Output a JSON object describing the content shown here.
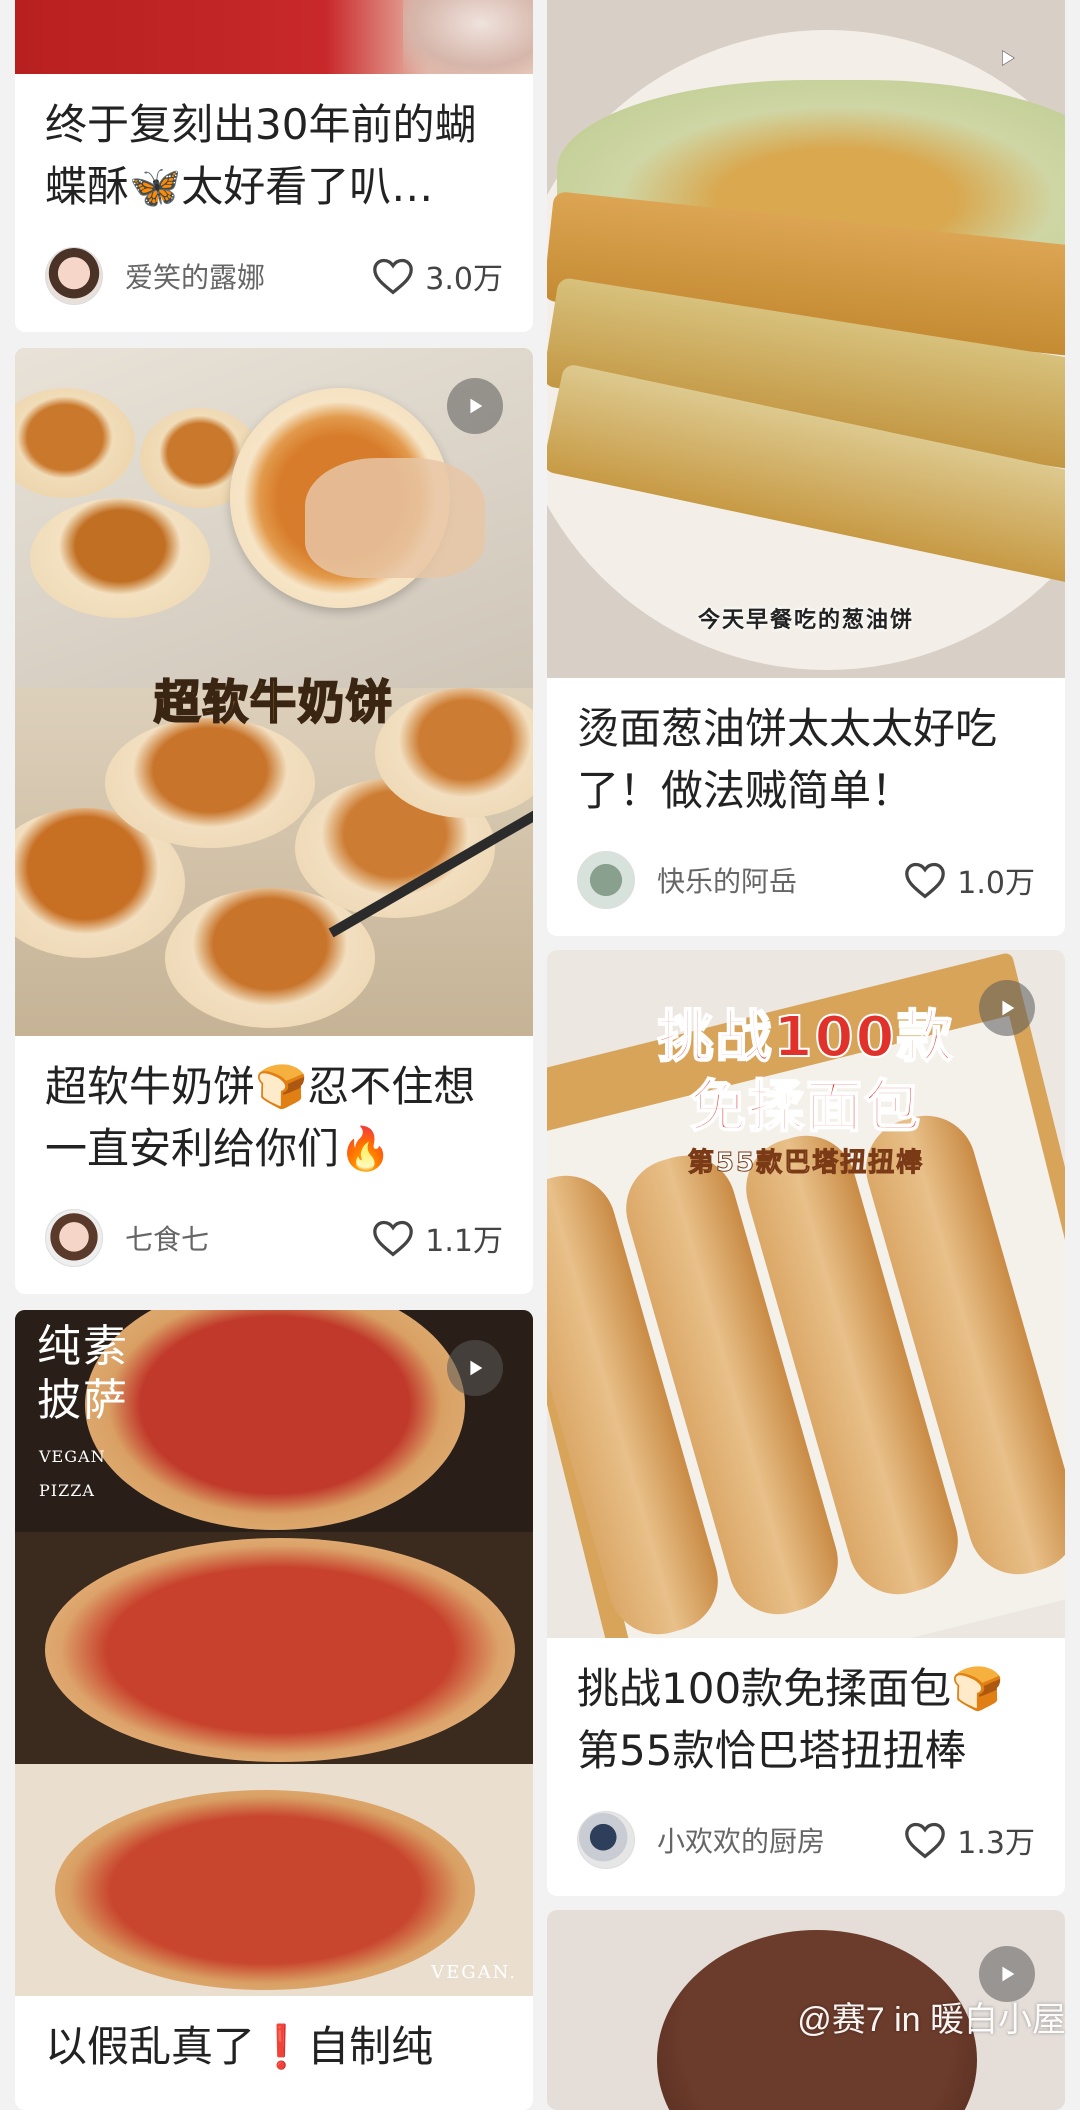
{
  "feed": {
    "left": [
      {
        "title": "终于复刻出30年前的蝴蝶酥🦋太好看了叭…",
        "author": "爱笑的露娜",
        "likes": "3.0万",
        "has_play": false
      },
      {
        "image_caption": "超软牛奶饼",
        "title": "超软牛奶饼🍞忍不住想一直安利给你们🔥",
        "author": "七食七",
        "likes": "1.1万",
        "has_play": true
      },
      {
        "image_caption_main": "纯素\n披萨",
        "image_caption_sub": "VEGAN\nPIZZA",
        "image_caption_bottom": "VEGAN.",
        "title": "以假乱真了❗自制纯",
        "has_play": true
      }
    ],
    "right": [
      {
        "image_caption": "今天早餐吃的葱油饼",
        "title": "烫面葱油饼太太太好吃了！做法贼简单！",
        "author": "快乐的阿岳",
        "likes": "1.0万",
        "has_play": true
      },
      {
        "image_caption_line1": "挑战100款",
        "image_caption_line2": "免揉面包",
        "image_caption_line3": "第55款巴塔扭扭棒",
        "title": "挑战100款免揉面包🍞第55款恰巴塔扭扭棒",
        "author": "小欢欢的厨房",
        "likes": "1.3万",
        "has_play": true
      },
      {
        "has_play": true
      }
    ]
  },
  "watermark": "@赛7 in 暖白小屋",
  "icons": {
    "play": "play-icon",
    "like": "heart-outline-icon"
  },
  "colors": {
    "background": "#f2f2f2",
    "card": "#ffffff",
    "title_text": "#222222",
    "meta_text": "#666666",
    "caption_yellow": "#f6c642",
    "caption_red": "#e0322a"
  }
}
